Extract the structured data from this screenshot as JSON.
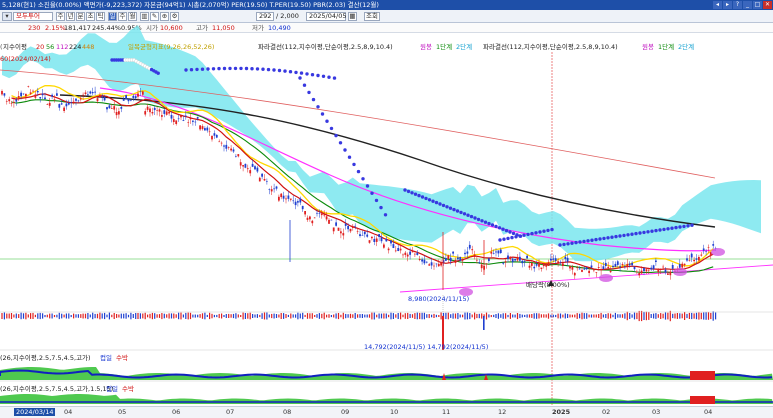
{
  "title_bar": {
    "text": "5,128(현1) 소진율(0.00%) 액면가(-9,223,372) 자본금(94억1) 시총(2,070억) PER(19.50) T.PER(19.50) PBR(2.03) 결산(12월)",
    "controls": [
      "◂",
      "▸",
      "?",
      "_",
      "□",
      "✕"
    ]
  },
  "toolbar": {
    "stock_name": "모두투어",
    "change": "230",
    "change_pct": "2.15%",
    "period_buttons": [
      "주",
      "년",
      "분",
      "초",
      "틱"
    ],
    "mode_buttons": [
      "일",
      "주",
      "월"
    ],
    "count_value": "292",
    "count_total": "/ 2,000",
    "date_value": "2025/04/05",
    "query_label": "조회",
    "spin_value": "1",
    "stat_labels": [
      "시가",
      "고가",
      "저가"
    ]
  },
  "info_row": {
    "items": [
      "230",
      "2.15%",
      "181,417",
      "245.44%",
      "0.95%",
      "시가",
      "10,600",
      "고가",
      "11,050",
      "저가",
      "10,490"
    ],
    "item_colors": [
      "#d01010",
      "#d01010",
      "#222222",
      "#222222",
      "#222222",
      "#555555",
      "#d01010",
      "#555555",
      "#d01010",
      "#555555",
      "#1030d0"
    ]
  },
  "indicator_row": {
    "ma_label": "지수이평",
    "ma_periods": [
      "20",
      "56",
      "112",
      "224",
      "448"
    ],
    "ma_colors": [
      "#d01010",
      "#0a8a0a",
      "#c010c0",
      "#222222",
      "#d08000"
    ],
    "ichimoku_label": "일목균형지표(9,26,26,52,26)",
    "ichimoku_color": "#c0a000",
    "wave1_label": "파라결선(112,지수이평,단순이평,2.5,8,9,10.4)",
    "wave1_tags": [
      "원봉",
      "1단계",
      "2단계"
    ],
    "wave2_label": "파라결선(112,지수이평,단순이평,2.5,8,9,10.4)",
    "wave2_tags": [
      "원봉",
      "1단계",
      "2단계"
    ],
    "wave_tag_colors": [
      "#c010c0",
      "#0a8a0a",
      "#10a0d0"
    ]
  },
  "price_labels": {
    "top_left": "60(2024/02/14)",
    "low_annotation": "8,980(2024/11/15)",
    "dividend_annotation": "배당락(8.00%)",
    "volume_low": "14,792(2024/11/5) 14,792(2024/11/5)"
  },
  "sub_indicators": {
    "macd1_label": "(26,지수이평,2.5,7.5,4.5,고가)",
    "macd1_tags": [
      "컵일",
      "수박"
    ],
    "macd2_label": "(26,지수이평,2.5,7.5,4.5,고가,1.5,15)",
    "macd2_tags": [
      "컵일",
      "수박"
    ],
    "tag_colors": [
      "#1030d0",
      "#d01010"
    ]
  },
  "x_axis": {
    "highlight_date": "2024/03/14",
    "ticks": [
      "03",
      "04",
      "05",
      "06",
      "07",
      "08",
      "09",
      "10",
      "11",
      "12",
      "2025",
      "02",
      "03",
      "04"
    ]
  },
  "colors": {
    "up": "#e02020",
    "down": "#1f3fd0",
    "cloud": "#7ae6ee",
    "ma20": "#d01010",
    "ma56": "#0a8a0a",
    "ma112": "#ff30ff",
    "ma224": "#222222",
    "ma448": "#e06060",
    "yellow": "#ffd800",
    "parabolic": "#3838e0"
  }
}
